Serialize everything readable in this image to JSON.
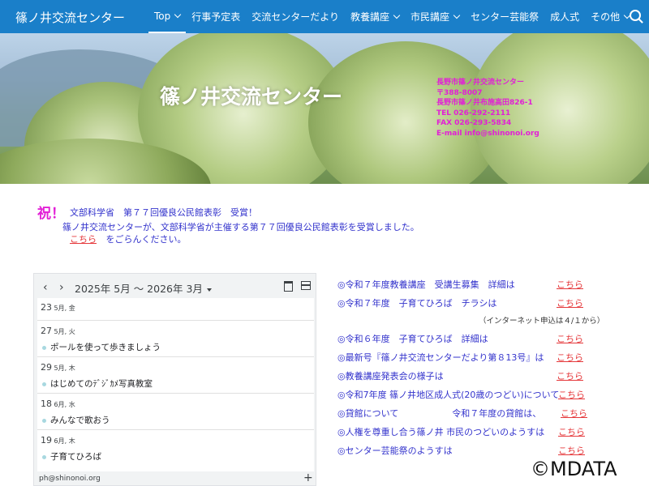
{
  "site": {
    "title": "篠ノ井交流センター"
  },
  "nav": {
    "items": [
      {
        "label": "Top",
        "has_dropdown": true,
        "active": true
      },
      {
        "label": "行事予定表",
        "has_dropdown": false
      },
      {
        "label": "交流センターだより",
        "has_dropdown": false
      },
      {
        "label": "教養講座",
        "has_dropdown": true
      },
      {
        "label": "市民講座",
        "has_dropdown": true
      },
      {
        "label": "センター芸能祭",
        "has_dropdown": false
      },
      {
        "label": "成人式",
        "has_dropdown": false
      },
      {
        "label": "その他",
        "has_dropdown": true
      }
    ],
    "search_icon": "search-icon"
  },
  "hero": {
    "title": "篠ノ井交流センター",
    "contact_lines": [
      "長野市篠ノ井交流センター",
      "〒388-8007",
      "長野市篠ノ井布施高田826-1",
      "TEL 026-292-2111",
      "FAX 026-293-5834",
      "E-mail info@shinonoi.org"
    ]
  },
  "notice": {
    "mark": "祝！",
    "headline": "文部科学省　第７７回優良公民館表彰　受賞！",
    "body": "篠ノ井交流センターが、文部科学省が主催する第７７回優良公民館表彰を受賞しました。",
    "link": "こちら",
    "link_suffix": "をごらんください。"
  },
  "calendar": {
    "prev": "‹",
    "next": "›",
    "range": "2025年 5月 〜 2026年 3月",
    "entries": [
      {
        "day": "23",
        "meta": "5月, 金",
        "event": ""
      },
      {
        "day": "27",
        "meta": "5月, 火",
        "event": "ポールを使って歩きましょう"
      },
      {
        "day": "29",
        "meta": "5月, 木",
        "event": "はじめてのﾃﾞｼﾞｶﾒ写真教室"
      },
      {
        "day": "18",
        "meta": "6月, 水",
        "event": "みんなで歌おう"
      },
      {
        "day": "19",
        "meta": "6月, 木",
        "event": "子育てひろば"
      }
    ],
    "footer": "ph@shinonoi.org",
    "add": "+"
  },
  "links": {
    "items": [
      {
        "text": "◎令和７年度教養講座　受講生募集　詳細は",
        "link": "こちら"
      },
      {
        "text": "◎令和７年度　子育てひろば　チラシは",
        "link": "こちら"
      },
      {
        "text": "◎令和６年度　子育てひろば　詳細は",
        "link": "こちら"
      },
      {
        "text": "◎最新号『篠ノ井交流センターだより第８13号』は",
        "link": "こちら"
      },
      {
        "text": "◎教養講座発表会の様子は",
        "link": "こちら"
      },
      {
        "text": "◎令和7年度 篠ノ井地区成人式(20歳のつどい)について",
        "link": "こちら"
      },
      {
        "text": "◎貸館について　　　　　　令和７年度の貸館は、",
        "link": "こちら"
      },
      {
        "text": "◎人権を尊重し合う篠ノ井 市民のつどいのようすは",
        "link": "こちら"
      },
      {
        "text": "◎センター芸能祭のようすは",
        "link": "こちら"
      }
    ],
    "note": "（インターネット申込は４/１から）"
  },
  "watermark": "©MDATA"
}
